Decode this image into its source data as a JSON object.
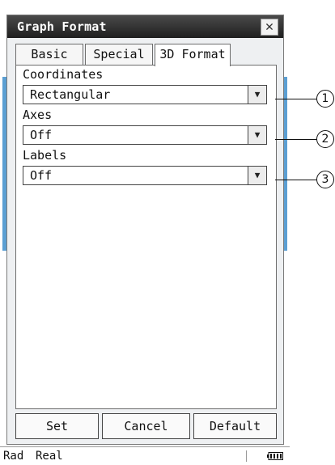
{
  "dialog": {
    "title": "Graph Format",
    "close_glyph": "✕",
    "tabs": [
      {
        "label": "Basic"
      },
      {
        "label": "Special"
      },
      {
        "label": "3D Format"
      }
    ],
    "active_tab": "3D Format",
    "fields": [
      {
        "label": "Coordinates",
        "value": "Rectangular"
      },
      {
        "label": "Axes",
        "value": "Off"
      },
      {
        "label": "Labels",
        "value": "Off"
      }
    ],
    "dropdown_arrow": "▼",
    "buttons": {
      "set": "Set",
      "cancel": "Cancel",
      "default": "Default"
    }
  },
  "statusbar": {
    "angle": "Rad",
    "mode": "Real",
    "battery_icon": "battery-icon"
  },
  "callouts": [
    "1",
    "2",
    "3"
  ],
  "colors": {
    "titlebar": "#2b2b2b",
    "side_accent": "#5b9fd3",
    "panel": "#ffffff"
  }
}
